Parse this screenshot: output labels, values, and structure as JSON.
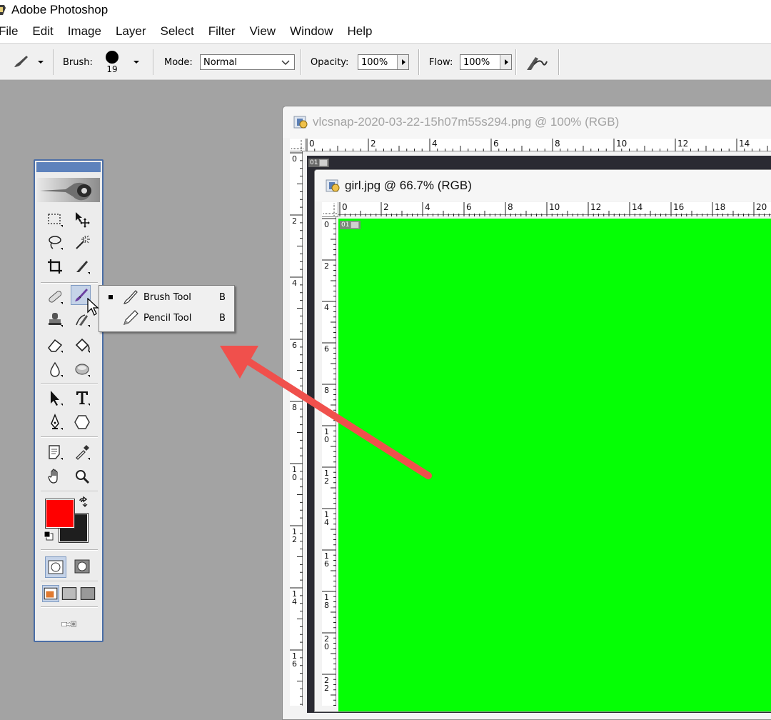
{
  "titlebar": {
    "title": "Adobe Photoshop"
  },
  "menubar": {
    "items": [
      "File",
      "Edit",
      "Image",
      "Layer",
      "Select",
      "Filter",
      "View",
      "Window",
      "Help"
    ]
  },
  "options": {
    "brush_label": "Brush:",
    "brush_size": "19",
    "mode_label": "Mode:",
    "mode_value": "Normal",
    "opacity_label": "Opacity:",
    "opacity_value": "100%",
    "flow_label": "Flow:",
    "flow_value": "100%",
    "airbrush_icon": "airbrush-icon"
  },
  "toolbox": {
    "tools": [
      [
        "marquee-icon",
        "move-icon"
      ],
      [
        "lasso-icon",
        "magic-wand-icon"
      ],
      [
        "crop-icon",
        "slice-icon"
      ],
      [
        "healing-brush-icon",
        "brush-icon"
      ],
      [
        "clone-stamp-icon",
        "history-brush-icon"
      ],
      [
        "eraser-icon",
        "paint-bucket-icon"
      ],
      [
        "blur-icon",
        "dodge-icon"
      ],
      [
        "path-selection-icon",
        "type-icon"
      ],
      [
        "pen-icon",
        "shape-icon"
      ],
      [
        "notes-icon",
        "eyedropper-icon"
      ],
      [
        "hand-icon",
        "zoom-icon"
      ]
    ],
    "foreground_color": "#ff0000",
    "background_color": "#1e1e1e"
  },
  "flyout": {
    "items": [
      {
        "label": "Brush Tool",
        "shortcut": "B",
        "selected": true
      },
      {
        "label": "Pencil Tool",
        "shortcut": "B",
        "selected": false
      }
    ]
  },
  "doc1": {
    "title": "vlcsnap-2020-03-22-15h07m55s294.png @ 100% (RGB)",
    "ruler_h": [
      "0",
      "2",
      "4",
      "6",
      "8",
      "10",
      "12",
      "14"
    ],
    "ruler_v": [
      "0",
      "2",
      "4",
      "6",
      "8",
      "1 0",
      "1 2",
      "1 4",
      "1 6"
    ],
    "layer_tag": "01"
  },
  "doc2": {
    "title": "girl.jpg @ 66.7% (RGB)",
    "ruler_h": [
      "0",
      "2",
      "4",
      "6",
      "8",
      "10",
      "12",
      "14",
      "16",
      "18",
      "20"
    ],
    "ruler_v": [
      "0",
      "2",
      "4",
      "6",
      "8",
      "1 0",
      "1 2",
      "1 4",
      "1 6",
      "1 8",
      "2 0",
      "2 2"
    ],
    "layer_tag": "01",
    "canvas_color": "#05ff05"
  },
  "annotation": {
    "arrow_color": "#f0504c"
  }
}
